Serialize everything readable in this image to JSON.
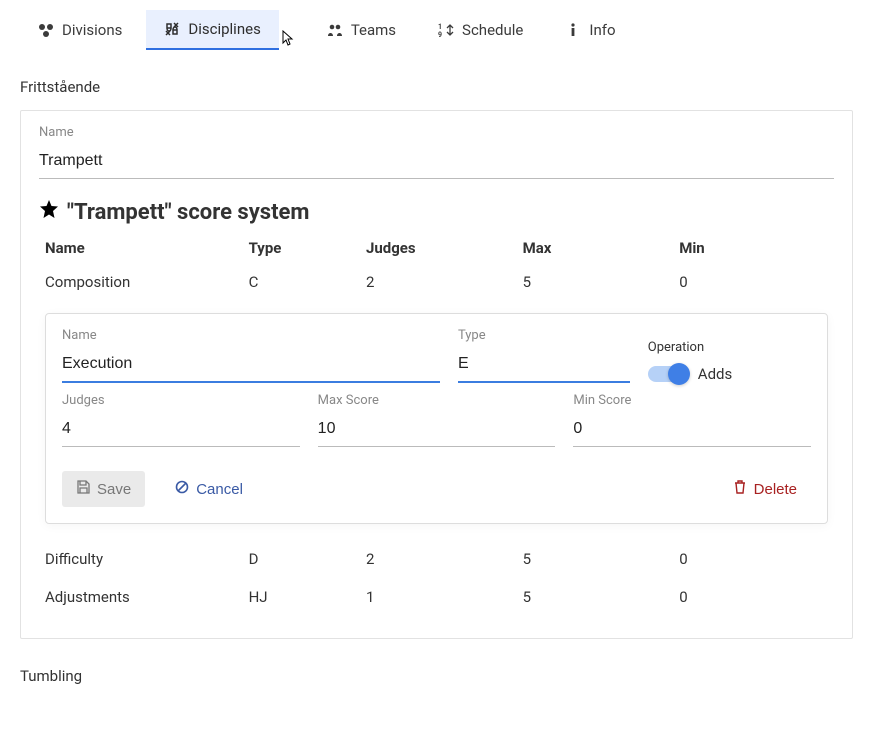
{
  "tabs": {
    "divisions": "Divisions",
    "disciplines": "Disciplines",
    "teams": "Teams",
    "schedule": "Schedule",
    "info": "Info"
  },
  "sections": {
    "frittstaende": "Frittstående",
    "tumbling": "Tumbling"
  },
  "nameField": {
    "label": "Name",
    "value": "Trampett"
  },
  "scoreSystem": {
    "title": "\"Trampett\" score system"
  },
  "tableHeaders": {
    "name": "Name",
    "type": "Type",
    "judges": "Judges",
    "max": "Max",
    "min": "Min"
  },
  "rows": {
    "composition": {
      "name": "Composition",
      "type": "C",
      "judges": "2",
      "max": "5",
      "min": "0"
    },
    "difficulty": {
      "name": "Difficulty",
      "type": "D",
      "judges": "2",
      "max": "5",
      "min": "0"
    },
    "adjustments": {
      "name": "Adjustments",
      "type": "HJ",
      "judges": "1",
      "max": "5",
      "min": "0"
    }
  },
  "editor": {
    "labels": {
      "name": "Name",
      "type": "Type",
      "operation": "Operation",
      "judges": "Judges",
      "maxScore": "Max Score",
      "minScore": "Min Score"
    },
    "values": {
      "name": "Execution",
      "type": "E",
      "judges": "4",
      "maxScore": "10",
      "minScore": "0"
    },
    "operation": {
      "label": "Adds",
      "on": true
    },
    "buttons": {
      "save": "Save",
      "cancel": "Cancel",
      "delete": "Delete"
    }
  }
}
